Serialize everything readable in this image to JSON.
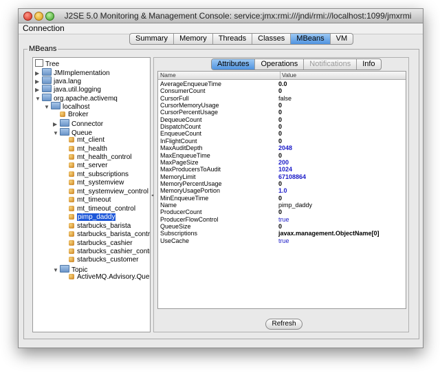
{
  "window": {
    "title": "J2SE 5.0 Monitoring & Management Console: service:jmx:rmi:///jndi/rmi://localhost:1099/jmxrmi"
  },
  "menu": {
    "connection": "Connection"
  },
  "main_tabs": [
    "Summary",
    "Memory",
    "Threads",
    "Classes",
    "MBeans",
    "VM"
  ],
  "main_tabs_active": "MBeans",
  "mbeans_label": "MBeans",
  "tree": {
    "root": "Tree",
    "nodes": [
      {
        "label": "JMImplementation",
        "depth": 1,
        "type": "folder",
        "disc": "▶"
      },
      {
        "label": "java.lang",
        "depth": 1,
        "type": "folder",
        "disc": "▶"
      },
      {
        "label": "java.util.logging",
        "depth": 1,
        "type": "folder",
        "disc": "▶"
      },
      {
        "label": "org.apache.activemq",
        "depth": 1,
        "type": "folder",
        "disc": "▼"
      },
      {
        "label": "localhost",
        "depth": 2,
        "type": "folder",
        "disc": "▼"
      },
      {
        "label": "Broker",
        "depth": 3,
        "type": "bean",
        "disc": ""
      },
      {
        "label": "Connector",
        "depth": 3,
        "type": "folder",
        "disc": "▶"
      },
      {
        "label": "Queue",
        "depth": 3,
        "type": "folder",
        "disc": "▼"
      },
      {
        "label": "mt_client",
        "depth": 4,
        "type": "bean",
        "disc": ""
      },
      {
        "label": "mt_health",
        "depth": 4,
        "type": "bean",
        "disc": ""
      },
      {
        "label": "mt_health_control",
        "depth": 4,
        "type": "bean",
        "disc": ""
      },
      {
        "label": "mt_server",
        "depth": 4,
        "type": "bean",
        "disc": ""
      },
      {
        "label": "mt_subscriptions",
        "depth": 4,
        "type": "bean",
        "disc": ""
      },
      {
        "label": "mt_systemview",
        "depth": 4,
        "type": "bean",
        "disc": ""
      },
      {
        "label": "mt_systemview_control",
        "depth": 4,
        "type": "bean",
        "disc": ""
      },
      {
        "label": "mt_timeout",
        "depth": 4,
        "type": "bean",
        "disc": ""
      },
      {
        "label": "mt_timeout_control",
        "depth": 4,
        "type": "bean",
        "disc": ""
      },
      {
        "label": "pimp_daddy",
        "depth": 4,
        "type": "bean",
        "disc": "",
        "selected": true
      },
      {
        "label": "starbucks_barista",
        "depth": 4,
        "type": "bean",
        "disc": ""
      },
      {
        "label": "starbucks_barista_control",
        "depth": 4,
        "type": "bean",
        "disc": ""
      },
      {
        "label": "starbucks_cashier",
        "depth": 4,
        "type": "bean",
        "disc": ""
      },
      {
        "label": "starbucks_cashier_control",
        "depth": 4,
        "type": "bean",
        "disc": ""
      },
      {
        "label": "starbucks_customer",
        "depth": 4,
        "type": "bean",
        "disc": ""
      },
      {
        "label": "Topic",
        "depth": 3,
        "type": "folder",
        "disc": "▼"
      },
      {
        "label": "ActiveMQ.Advisory.Queue",
        "depth": 4,
        "type": "bean",
        "disc": ""
      }
    ]
  },
  "sub_tabs": [
    {
      "label": "Attributes",
      "state": "active"
    },
    {
      "label": "Operations",
      "state": "normal"
    },
    {
      "label": "Notifications",
      "state": "disabled"
    },
    {
      "label": "Info",
      "state": "normal"
    }
  ],
  "table": {
    "headers": {
      "name": "Name",
      "value": "Value"
    },
    "rows": [
      {
        "name": "AverageEnqueueTime",
        "value": "0.0",
        "style": "bold"
      },
      {
        "name": "ConsumerCount",
        "value": "0",
        "style": "bold"
      },
      {
        "name": "CursorFull",
        "value": "false",
        "style": "plain"
      },
      {
        "name": "CursorMemoryUsage",
        "value": "0",
        "style": "bold"
      },
      {
        "name": "CursorPercentUsage",
        "value": "0",
        "style": "bold"
      },
      {
        "name": "DequeueCount",
        "value": "0",
        "style": "bold"
      },
      {
        "name": "DispatchCount",
        "value": "0",
        "style": "bold"
      },
      {
        "name": "EnqueueCount",
        "value": "0",
        "style": "bold"
      },
      {
        "name": "InFlightCount",
        "value": "0",
        "style": "bold"
      },
      {
        "name": "MaxAuditDepth",
        "value": "2048",
        "style": "blue"
      },
      {
        "name": "MaxEnqueueTime",
        "value": "0",
        "style": "bold"
      },
      {
        "name": "MaxPageSize",
        "value": "200",
        "style": "blue"
      },
      {
        "name": "MaxProducersToAudit",
        "value": "1024",
        "style": "blue"
      },
      {
        "name": "MemoryLimit",
        "value": "67108864",
        "style": "blue"
      },
      {
        "name": "MemoryPercentUsage",
        "value": "0",
        "style": "bold"
      },
      {
        "name": "MemoryUsagePortion",
        "value": "1.0",
        "style": "blue"
      },
      {
        "name": "MinEnqueueTime",
        "value": "0",
        "style": "bold"
      },
      {
        "name": "Name",
        "value": "pimp_daddy",
        "style": "plain"
      },
      {
        "name": "ProducerCount",
        "value": "0",
        "style": "bold"
      },
      {
        "name": "ProducerFlowControl",
        "value": "true",
        "style": "link"
      },
      {
        "name": "QueueSize",
        "value": "0",
        "style": "bold"
      },
      {
        "name": "Subscriptions",
        "value": "javax.management.ObjectName[0]",
        "style": "bold"
      },
      {
        "name": "UseCache",
        "value": "true",
        "style": "link"
      }
    ]
  },
  "refresh_label": "Refresh",
  "colors": {
    "selection": "#1c56d8",
    "active_tab": "#4f93e0",
    "value_blue": "#1a1ac8"
  }
}
